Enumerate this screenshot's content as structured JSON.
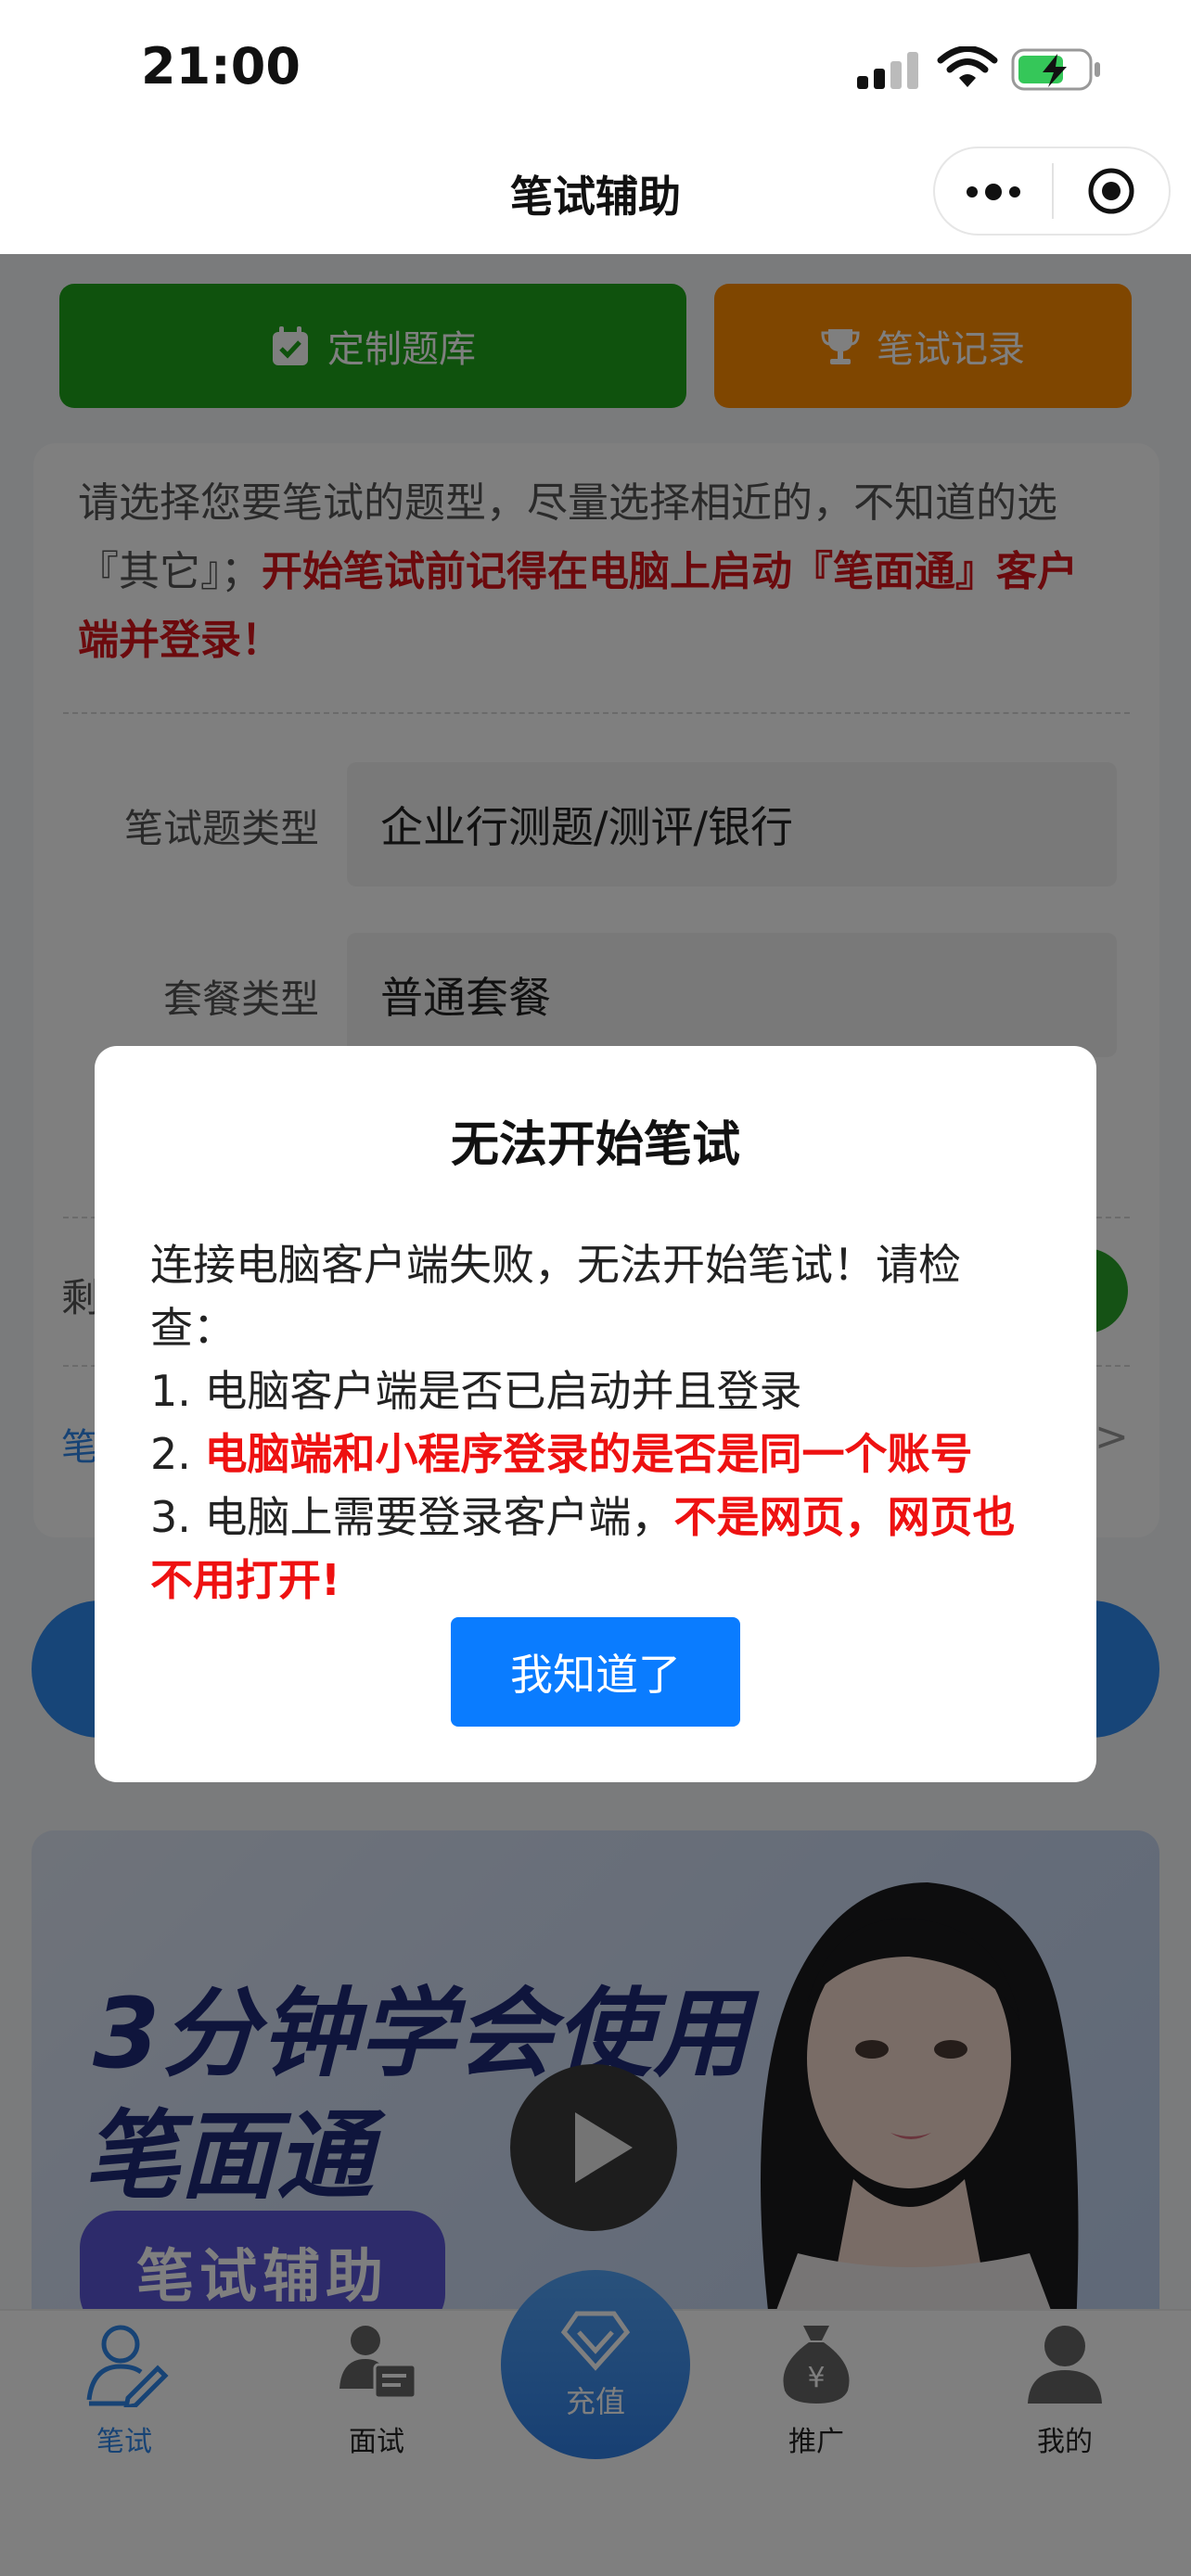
{
  "status_bar": {
    "time": "21:00"
  },
  "nav": {
    "title": "笔试辅助"
  },
  "top_buttons": {
    "custom_bank": "定制题库",
    "exam_records": "笔试记录"
  },
  "form": {
    "intro_normal": "请选择您要笔试的题型，尽量选择相近的，不知道的选『其它』；",
    "intro_red": "开始笔试前记得在电脑上启动『笔面通』客户端并登录！",
    "exam_type_label": "笔试题类型",
    "exam_type_value": "企业行测题/测评/银行",
    "package_label": "套餐类型",
    "package_value": "普通套餐",
    "remaining_label_partial": "剩",
    "link_partial": "笔",
    "chevron": ">"
  },
  "banner": {
    "title_line1": "3分钟学会使用",
    "title_line2": "笔面通",
    "pill": "笔试辅助"
  },
  "tabbar": {
    "items": [
      {
        "label": "笔试",
        "active": true,
        "icon": "pen-person-icon"
      },
      {
        "label": "面试",
        "active": false,
        "icon": "interview-icon"
      },
      {
        "label": "充值",
        "active": false,
        "icon": "diamond-icon"
      },
      {
        "label": "推广",
        "active": false,
        "icon": "money-bag-icon"
      },
      {
        "label": "我的",
        "active": false,
        "icon": "user-icon"
      }
    ]
  },
  "modal": {
    "title": "无法开始笔试",
    "line1": "连接电脑客户端失败，无法开始笔试！请检查：",
    "item1": "1. 电脑客户端是否已启动并且登录",
    "item2_prefix": "2. ",
    "item2_red": "电脑端和小程序登录的是否是同一个账号",
    "item3_prefix": "3. 电脑上需要登录客户端，",
    "item3_red": "不是网页，网页也不用打开!",
    "button": "我知道了"
  },
  "colors": {
    "green": "#1fa51a",
    "orange": "#ff8c00",
    "accent_blue": "#0a7cff",
    "warning_red": "#ee1111"
  }
}
